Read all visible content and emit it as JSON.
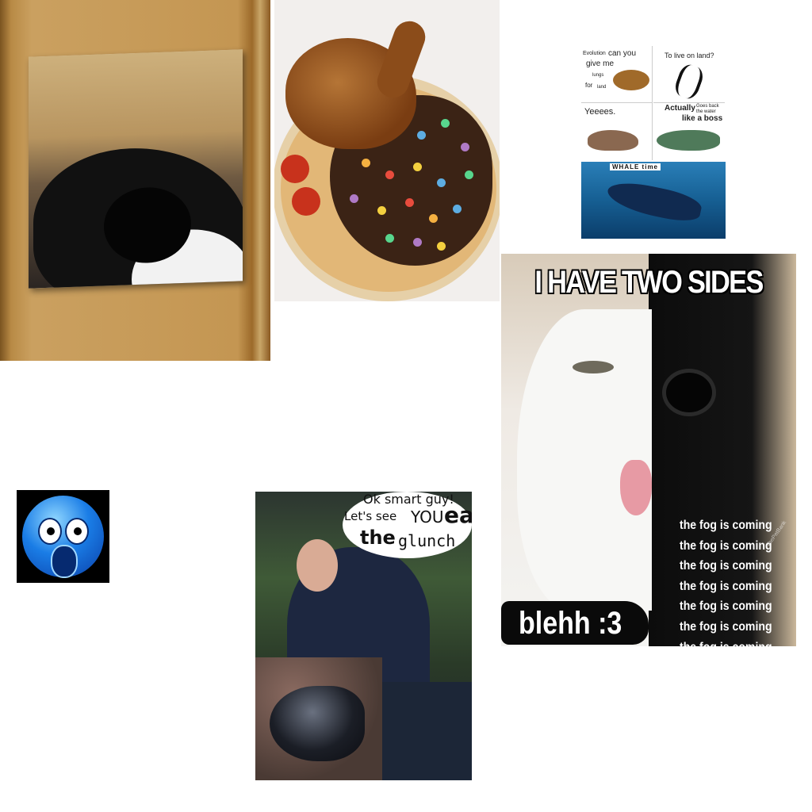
{
  "images": {
    "cat_canvas": {
      "label": ""
    },
    "chicken_pizza": {
      "label": ""
    },
    "evolution_meme": {
      "q1_a": "Evolution",
      "q1_b": "can you",
      "q1_c": "give me",
      "q1_d": "lungs",
      "q1_e": "for",
      "q1_f": "land",
      "q2": "To live on land?",
      "q3": "Yeeees.",
      "q4_a": "Actually",
      "q4_b": "Goes back",
      "q4_c": "the water",
      "q4_d": "like a boss",
      "whale_label": "WHALE time"
    },
    "two_sides_cat": {
      "title": "I HAVE TWO SIDES",
      "fog_lines": [
        "the fog is coming",
        "the fog is coming",
        "the fog is coming",
        "the fog is coming",
        "the fog is coming",
        "the fog is coming",
        "the fog is coming"
      ],
      "caption": "blehh :3",
      "watermark": "ThePetBank"
    },
    "emoji": {
      "label": ""
    },
    "glunch_meme": {
      "line1": "Ok smart guy!",
      "line2_a": "Let's see",
      "line2_b": "YOU",
      "line2_c": "eat",
      "line3_a": "the",
      "line3_b": "glunch"
    }
  }
}
